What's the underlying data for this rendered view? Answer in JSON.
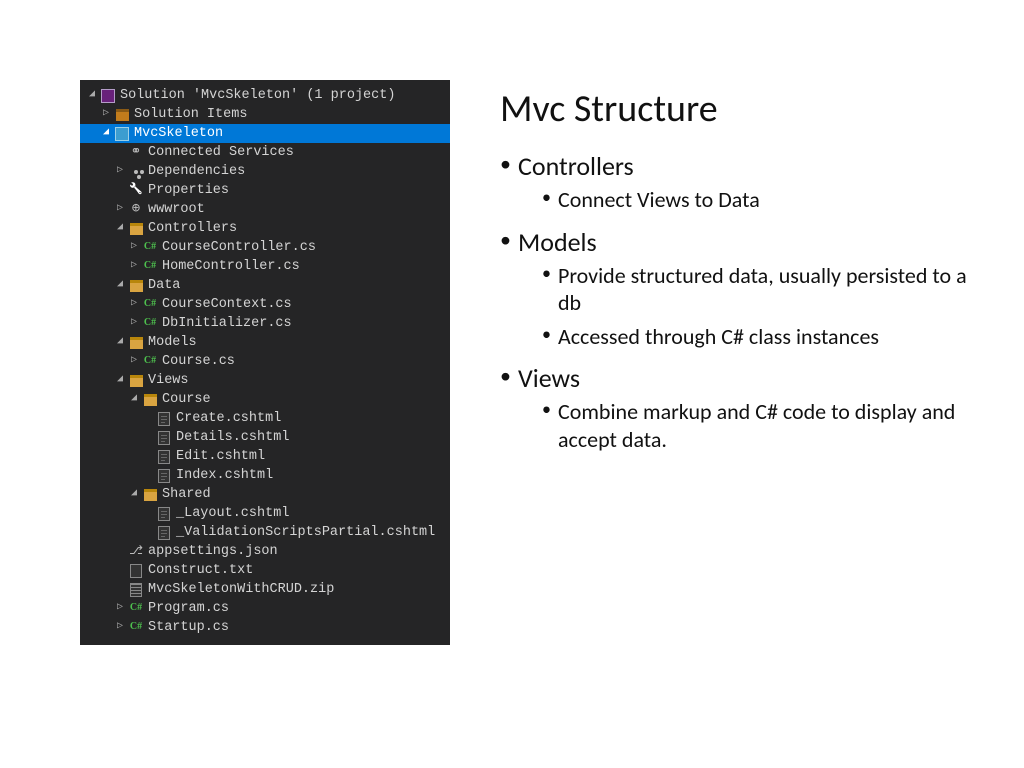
{
  "slide": {
    "title": "Mvc Structure",
    "bullets": [
      {
        "label": "Controllers",
        "sub": [
          "Connect Views to Data"
        ]
      },
      {
        "label": "Models",
        "sub": [
          "Provide structured data, usually persisted to a db",
          "Accessed through C# class instances"
        ]
      },
      {
        "label": "Views",
        "sub": [
          "Combine markup and C# code to display and accept data."
        ]
      }
    ]
  },
  "explorer": {
    "rows": [
      {
        "depth": 0,
        "exp": "open",
        "icon": "sln",
        "label": "Solution 'MvcSkeleton' (1 project)",
        "sel": false
      },
      {
        "depth": 1,
        "exp": "closed",
        "icon": "folder-sol",
        "label": "Solution Items",
        "sel": false
      },
      {
        "depth": 1,
        "exp": "open",
        "icon": "proj",
        "label": "MvcSkeleton",
        "sel": true
      },
      {
        "depth": 2,
        "exp": "none",
        "icon": "plug",
        "label": "Connected Services",
        "sel": false
      },
      {
        "depth": 2,
        "exp": "closed",
        "icon": "deps",
        "label": "Dependencies",
        "sel": false
      },
      {
        "depth": 2,
        "exp": "none",
        "icon": "wrench",
        "label": "Properties",
        "sel": false
      },
      {
        "depth": 2,
        "exp": "closed",
        "icon": "globe",
        "label": "wwwroot",
        "sel": false
      },
      {
        "depth": 2,
        "exp": "open",
        "icon": "folder",
        "label": "Controllers",
        "sel": false
      },
      {
        "depth": 3,
        "exp": "closed",
        "icon": "cs",
        "label": "CourseController.cs",
        "sel": false
      },
      {
        "depth": 3,
        "exp": "closed",
        "icon": "cs",
        "label": "HomeController.cs",
        "sel": false
      },
      {
        "depth": 2,
        "exp": "open",
        "icon": "folder",
        "label": "Data",
        "sel": false
      },
      {
        "depth": 3,
        "exp": "closed",
        "icon": "cs",
        "label": "CourseContext.cs",
        "sel": false
      },
      {
        "depth": 3,
        "exp": "closed",
        "icon": "cs",
        "label": "DbInitializer.cs",
        "sel": false
      },
      {
        "depth": 2,
        "exp": "open",
        "icon": "folder",
        "label": "Models",
        "sel": false
      },
      {
        "depth": 3,
        "exp": "closed",
        "icon": "cs",
        "label": "Course.cs",
        "sel": false
      },
      {
        "depth": 2,
        "exp": "open",
        "icon": "folder",
        "label": "Views",
        "sel": false
      },
      {
        "depth": 3,
        "exp": "open",
        "icon": "folder",
        "label": "Course",
        "sel": false
      },
      {
        "depth": 4,
        "exp": "none",
        "icon": "cshtml",
        "label": "Create.cshtml",
        "sel": false
      },
      {
        "depth": 4,
        "exp": "none",
        "icon": "cshtml",
        "label": "Details.cshtml",
        "sel": false
      },
      {
        "depth": 4,
        "exp": "none",
        "icon": "cshtml",
        "label": "Edit.cshtml",
        "sel": false
      },
      {
        "depth": 4,
        "exp": "none",
        "icon": "cshtml",
        "label": "Index.cshtml",
        "sel": false
      },
      {
        "depth": 3,
        "exp": "open",
        "icon": "folder",
        "label": "Shared",
        "sel": false
      },
      {
        "depth": 4,
        "exp": "none",
        "icon": "cshtml",
        "label": "_Layout.cshtml",
        "sel": false
      },
      {
        "depth": 4,
        "exp": "none",
        "icon": "cshtml",
        "label": "_ValidationScriptsPartial.cshtml",
        "sel": false
      },
      {
        "depth": 2,
        "exp": "none",
        "icon": "json",
        "label": "appsettings.json",
        "sel": false
      },
      {
        "depth": 2,
        "exp": "none",
        "icon": "txt",
        "label": "Construct.txt",
        "sel": false
      },
      {
        "depth": 2,
        "exp": "none",
        "icon": "zip",
        "label": "MvcSkeletonWithCRUD.zip",
        "sel": false
      },
      {
        "depth": 2,
        "exp": "closed",
        "icon": "cs",
        "label": "Program.cs",
        "sel": false
      },
      {
        "depth": 2,
        "exp": "closed",
        "icon": "cs",
        "label": "Startup.cs",
        "sel": false
      }
    ]
  }
}
